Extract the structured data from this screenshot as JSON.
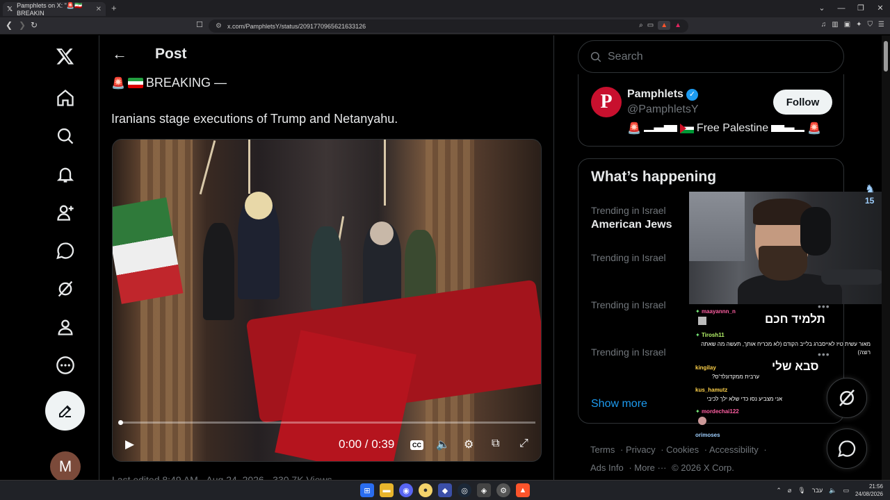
{
  "browser": {
    "tab_title": "Pamphlets on X: \"🚨🇮🇷 BREAKIN",
    "new_tab": "+",
    "url": "x.com/PamphletsY/status/2091770965621633126"
  },
  "post": {
    "header_title": "Post",
    "breaking_text": "BREAKING —",
    "body_text": "Iranians stage executions of Trump and Netanyahu.",
    "video_time": "0:00 / 0:39",
    "video_progress": 0.0,
    "cc_label": "CC",
    "below_text": "Last edited 8:49 AM · Aug 24, 2026 · 330.7K Views"
  },
  "sidebar": {
    "avatar_letter": "M"
  },
  "search": {
    "placeholder": "Search"
  },
  "profile_card": {
    "avatar_letter": "P",
    "name": "Pamphlets",
    "handle": "@PamphletsY",
    "bio_text": "Free Palestine",
    "follow_label": "Follow"
  },
  "happening": {
    "title": "What’s happening",
    "trends": [
      {
        "location": "Trending in Israel",
        "name": "American Jews"
      },
      {
        "location": "Trending in Israel",
        "name": ""
      },
      {
        "location": "Trending in Israel",
        "name": ""
      },
      {
        "location": "Trending in Israel",
        "name": ""
      }
    ],
    "show_more": "Show more"
  },
  "footer": {
    "terms": "Terms",
    "privacy": "Privacy",
    "cookies": "Cookies",
    "accessibility": "Accessibility",
    "ads_info": "Ads Info",
    "more": "More ···",
    "copyright": "© 2026 X Corp."
  },
  "stream": {
    "badge": "15",
    "chat": [
      {
        "user": "maayannn_n",
        "color": "#ff5fa2",
        "message": ""
      },
      {
        "user": "Tirosh11",
        "color": "#b7f56a",
        "message": "מאור עשית טיז לאייסברג בלייב הקודם (לא מכריח אותך, תעשה מה שאתה רוצה)"
      },
      {
        "user": "kingilay",
        "color": "#ffd24a",
        "message": "ערבית ממקדונלד'ס?"
      },
      {
        "user": "kus_hamutz",
        "color": "#ffd24a",
        "message": "אני מצביע נסו כדי שלא ילך לכיבי"
      },
      {
        "user": "mordechai122",
        "color": "#ff5fa2",
        "message": ""
      },
      {
        "user": "orimoses",
        "color": "#9fd0ff",
        "message": ""
      }
    ],
    "big_text_1": "תלמיד חכם",
    "big_text_2": "סבא שלי"
  },
  "taskbar": {
    "lang": "עבר",
    "time": "21:56",
    "date": "24/08/2026"
  },
  "colors": {
    "accent": "#1d9bf0",
    "background": "#000000",
    "border": "#2f3336"
  }
}
